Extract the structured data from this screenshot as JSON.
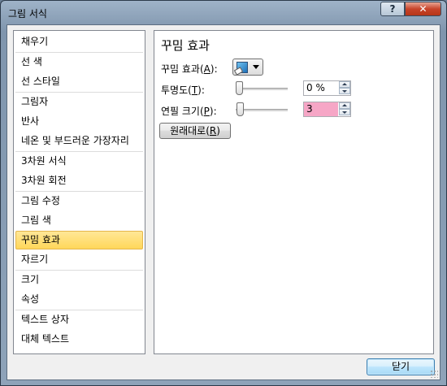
{
  "window": {
    "title": "그림 서식"
  },
  "titlebar_buttons": {
    "help": "?",
    "close": "✕"
  },
  "sidebar": {
    "items": [
      {
        "label": "채우기"
      },
      {
        "label": "선 색"
      },
      {
        "label": "선 스타일"
      },
      {
        "label": "그림자"
      },
      {
        "label": "반사"
      },
      {
        "label": "네온 및 부드러운 가장자리"
      },
      {
        "label": "3차원 서식"
      },
      {
        "label": "3차원 회전"
      },
      {
        "label": "그림 수정"
      },
      {
        "label": "그림 색"
      },
      {
        "label": "꾸밈 효과",
        "selected": true
      },
      {
        "label": "자르기"
      },
      {
        "label": "크기"
      },
      {
        "label": "속성"
      },
      {
        "label": "텍스트 상자"
      },
      {
        "label": "대체 텍스트"
      }
    ]
  },
  "panel": {
    "title": "꾸밈 효과",
    "effect": {
      "label_prefix": "꾸밈 효과(",
      "label_key": "A",
      "label_suffix": "):",
      "icon": "artistic-effect-thumbnail"
    },
    "transparency": {
      "label_prefix": "투명도(",
      "label_key": "T",
      "label_suffix": "):",
      "value": "0 %",
      "slider_fraction": 0.0
    },
    "pencil_size": {
      "label_prefix": "연필 크기(",
      "label_key": "P",
      "label_suffix": "):",
      "value": "3",
      "slider_fraction": 0.02
    },
    "reset": {
      "label_prefix": "원래대로(",
      "label_key": "R",
      "label_suffix": ")"
    }
  },
  "footer": {
    "close_label": "닫기"
  },
  "colors": {
    "selected_item": "#ffd75a",
    "field_highlight": "#f6a6c6",
    "default_button": "#bee6fd"
  }
}
